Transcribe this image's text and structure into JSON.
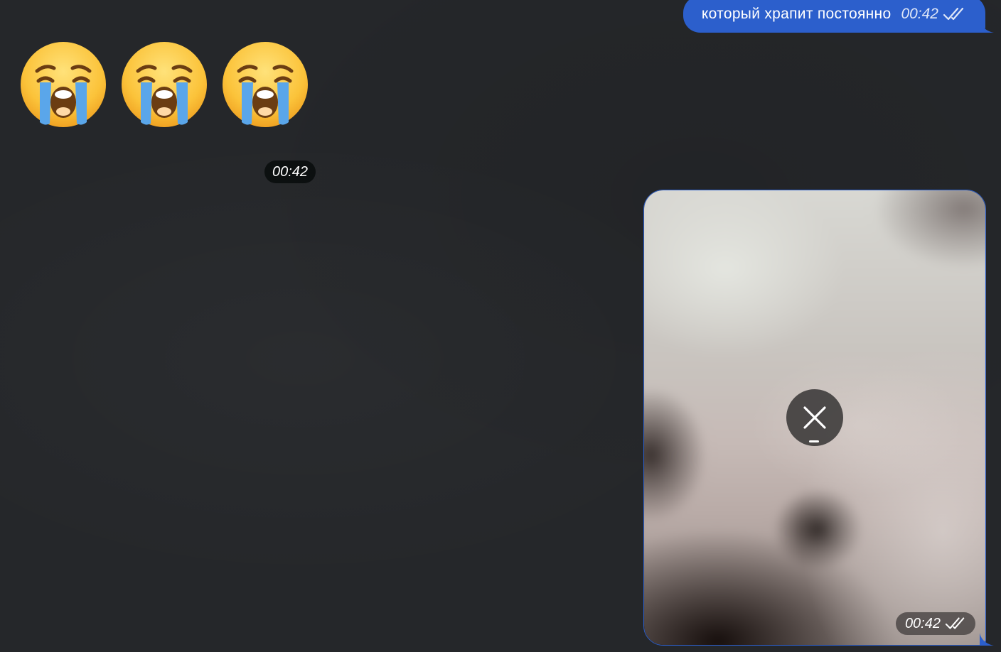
{
  "colors": {
    "background": "#25272a",
    "outgoing_bubble": "#2c5fcc",
    "text": "#ffffff"
  },
  "outgoing_text_message": {
    "text": "который храпит постоянно",
    "time": "00:42",
    "status_icon": "double-check-icon"
  },
  "emoji_message": {
    "emojis": [
      "😭",
      "😭",
      "😭"
    ],
    "emoji_icon": "loudly-crying-face-icon",
    "time": "00:42"
  },
  "video_message": {
    "time": "00:42",
    "status_icon": "double-check-icon",
    "action_icon": "close-icon"
  }
}
